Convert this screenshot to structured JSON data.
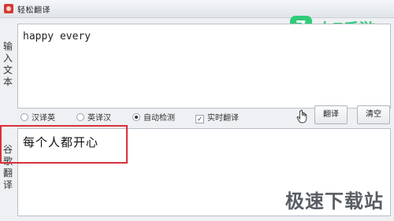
{
  "window": {
    "title": "轻松翻译",
    "app_icon": "app-logo-icon"
  },
  "watermark_top": {
    "badge": "7",
    "text": "小7手游",
    "color": "#2fcb7a"
  },
  "input_section": {
    "label": "输入文本",
    "value": "happy every"
  },
  "options": {
    "radio_cn_en": {
      "label": "汉译英",
      "checked": false
    },
    "radio_en_cn": {
      "label": "英译汉",
      "checked": false
    },
    "radio_auto": {
      "label": "自动检测",
      "checked": true
    },
    "checkbox_realtime": {
      "label": "实时翻译",
      "checked": true,
      "mark": "✓"
    },
    "hand_icon": "hand-pointer-icon"
  },
  "buttons": {
    "translate": "翻译",
    "clear": "清空"
  },
  "output_section": {
    "label": "谷歌翻译",
    "value": "每个人都开心",
    "highlight_color": "#d9303a"
  },
  "watermark_bottom": {
    "text": "极速下载站"
  }
}
